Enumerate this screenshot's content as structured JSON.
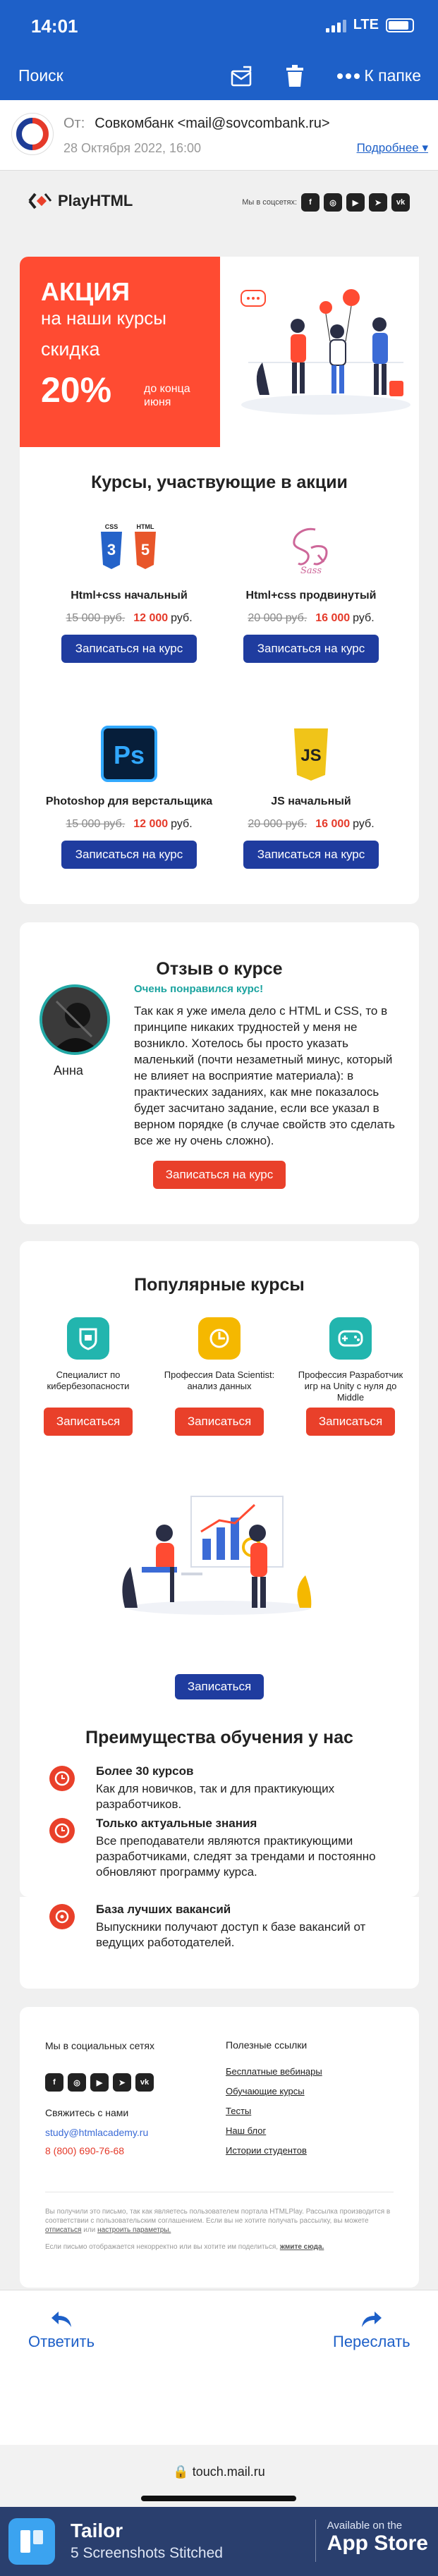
{
  "status_bar": {
    "time": "14:01",
    "network": "LTE"
  },
  "nav": {
    "back_label": "Поиск",
    "folder_label": "К папке",
    "icons": [
      "mail-reply-icon",
      "trash-icon",
      "more-icon"
    ]
  },
  "mail_header": {
    "from_label": "От:",
    "sender": "Совкомбанк <mail@sovcombank.ru>",
    "date": "28 Октября 2022, 16:00",
    "details_link": "Подробнее"
  },
  "brand": {
    "name": "PlayHTML",
    "social_label": "Мы в соцсетях:",
    "social": [
      "f",
      "ig",
      "yt",
      "tg",
      "vk"
    ]
  },
  "banner": {
    "line1": "АКЦИЯ",
    "line2": "на наши курсы",
    "line3": "скидка",
    "percent": "20%",
    "until": "до конца июня"
  },
  "sale_section": {
    "title": "Курсы, участвующие в акции",
    "currency": "руб.",
    "courses": [
      {
        "name": "Html+css начальный",
        "old_price": "15 000 руб.",
        "new_price": "12 000",
        "button": "Записаться на курс"
      },
      {
        "name": "Html+css продвинутый",
        "old_price": "20 000 руб.",
        "new_price": "16 000",
        "button": "Записаться на курс"
      },
      {
        "name": "Photoshop для верстальщика",
        "old_price": "15 000 руб.",
        "new_price": "12 000",
        "button": "Записаться на курс"
      },
      {
        "name": "JS начальный",
        "old_price": "20 000 руб.",
        "new_price": "16 000",
        "button": "Записаться на курс"
      }
    ]
  },
  "review": {
    "title": "Отзыв о курсе",
    "author": "Анна",
    "headline": "Очень понравился курс!",
    "text": "Так как я уже имела дело с HTML и CSS, то в принципе никаких трудностей у меня не возникло. Хотелось бы просто указать маленький (почти незаметный минус, который не влияет на восприятие материала): в практических заданиях, как мне показалось будет засчитано задание, если все указал в верном порядке (в случае свойств это сделать все же ну очень сложно).",
    "button": "Записаться на курс"
  },
  "popular": {
    "title": "Популярные курсы",
    "items": [
      {
        "name": "Специалист по кибербезопасности",
        "button": "Записаться"
      },
      {
        "name": "Профессия Data Scientist: анализ данных",
        "button": "Записаться"
      },
      {
        "name": "Профессия Разработчик игр на Unity с нуля до Middle",
        "button": "Записаться"
      }
    ],
    "main_button": "Записаться"
  },
  "advantages": {
    "title": "Преимущества обучения у нас",
    "items": [
      {
        "title": "Более 30 курсов",
        "text": "Как для новичков, так и для практикующих разработчиков."
      },
      {
        "title": "Только актуальные знания",
        "text": "Все преподаватели являются практикующими разработчиками, следят за трендами и постоянно обновляют программу курса."
      },
      {
        "title": "База лучших вакансий",
        "text": "Выпускники получают доступ к базе вакансий от ведущих работодателей."
      }
    ]
  },
  "footer": {
    "social_title": "Мы в социальных сетях",
    "contact_title": "Свяжитесь с нами",
    "email": "study@htmlacademy.ru",
    "phone": "8 (800) 690-76-68",
    "links_title": "Полезные ссылки",
    "links": [
      "Бесплатные вебинары",
      "Обучающие курсы",
      "Тесты",
      "Наш блог",
      "Истории студентов"
    ],
    "legal1": "Вы получили это письмо, так как являетесь пользователем портала HTMLPlay. Рассылка производится в соответствии с пользовательским соглашением. Если вы не хотите получать рассылку, вы можете",
    "legal1_link1": "отписаться",
    "legal1_mid": "или",
    "legal1_link2": "настроить параметры.",
    "legal2": "Если письмо отображается некорректно или вы хотите им поделиться,",
    "legal2_link": "жмите сюда."
  },
  "toolbar": {
    "reply": "Ответить",
    "forward": "Переслать"
  },
  "url_bar": {
    "url": "touch.mail.ru"
  },
  "ad": {
    "title": "Tailor",
    "subtitle": "5 Screenshots Stitched",
    "store_small": "Available on the",
    "store_big": "App Store"
  }
}
